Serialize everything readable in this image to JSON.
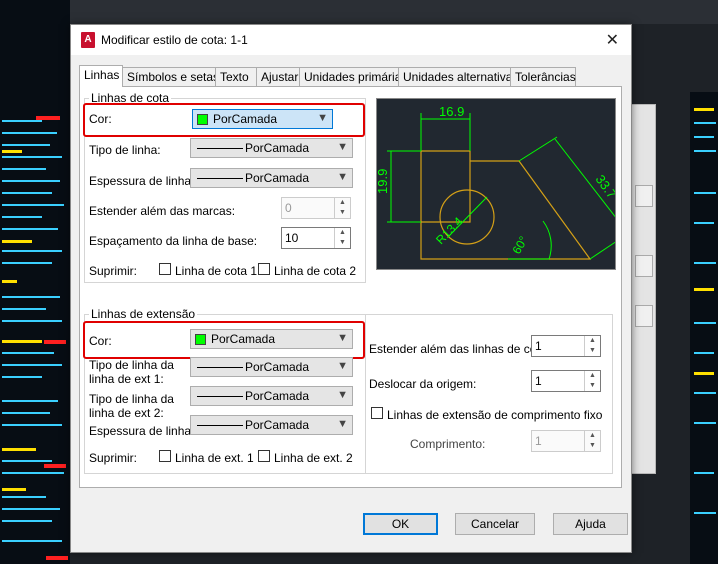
{
  "window": {
    "title": "Modificar estilo de cota: 1-1",
    "app_icon_letter": "A"
  },
  "tabs": [
    {
      "label": "Linhas",
      "active": true
    },
    {
      "label": "Símbolos e setas"
    },
    {
      "label": "Texto"
    },
    {
      "label": "Ajustar"
    },
    {
      "label": "Unidades primárias"
    },
    {
      "label": "Unidades alternativas"
    },
    {
      "label": "Tolerâncias"
    }
  ],
  "dim_lines": {
    "group_title": "Linhas de cota",
    "color_label": "Cor:",
    "color_value": "PorCamada",
    "linetype_label": "Tipo de linha:",
    "linetype_value": "PorCamada",
    "lineweight_label": "Espessura de linha:",
    "lineweight_value": "PorCamada",
    "extend_label": "Estender além das marcas:",
    "extend_value": "0",
    "baseline_label": "Espaçamento da linha de base:",
    "baseline_value": "10",
    "suppress_label": "Suprimir:",
    "suppress_1": "Linha de cota 1",
    "suppress_2": "Linha de cota 2"
  },
  "ext_lines": {
    "group_title": "Linhas de extensão",
    "color_label": "Cor:",
    "color_value": "PorCamada",
    "linetype1_label_a": "Tipo de linha da",
    "linetype1_label_b": "linha de ext 1:",
    "linetype1_value": "PorCamada",
    "linetype2_label_a": "Tipo de linha da",
    "linetype2_label_b": "linha de ext 2:",
    "linetype2_value": "PorCamada",
    "lineweight_label": "Espessura de linha:",
    "lineweight_value": "PorCamada",
    "suppress_label": "Suprimir:",
    "suppress_1": "Linha de ext. 1",
    "suppress_2": "Linha de ext. 2",
    "extend_beyond_label": "Estender além das linhas de cota:",
    "extend_beyond_value": "1",
    "offset_label": "Deslocar da origem:",
    "offset_value": "1",
    "fixed_length_label": "Linhas de extensão de comprimento fixo",
    "length_label": "Comprimento:",
    "length_value": "1"
  },
  "preview": {
    "dim_top": "16.9",
    "dim_left": "19.9",
    "dim_right": "33.7",
    "dim_radius": "R13.4",
    "dim_angle": "60°"
  },
  "buttons": {
    "ok": "OK",
    "cancel": "Cancelar",
    "help": "Ajuda"
  },
  "colors": {
    "highlight": "#e00000",
    "swatch": "#00ff00",
    "preview_bg": "#212830",
    "dim": "#00ff00",
    "geometry": "#d4a017"
  }
}
